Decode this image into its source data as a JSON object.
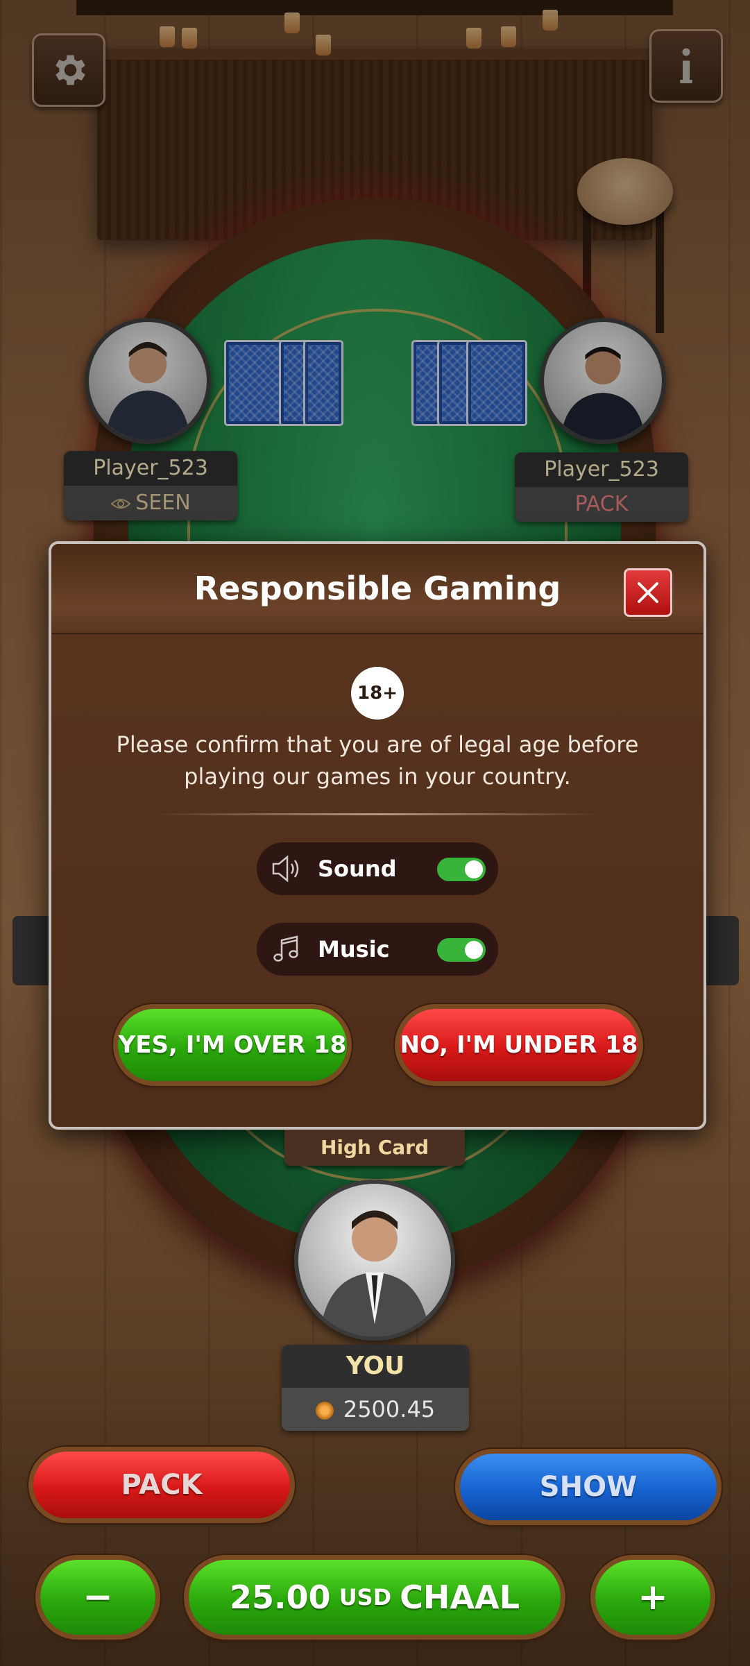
{
  "top_bar": {
    "settings_icon": "gear-icon",
    "info_icon": "info-icon"
  },
  "players": {
    "left": {
      "name": "Player_523",
      "status": "SEEN",
      "status_icon": "eye-icon"
    },
    "right": {
      "name": "Player_523",
      "status": "PACK",
      "status_color": "#e07a7a"
    }
  },
  "modal": {
    "title": "Responsible Gaming",
    "age_badge": "18+",
    "message_line1": "Please confirm that you are of legal age before",
    "message_line2": "playing our games in your country.",
    "toggles": [
      {
        "label": "Sound",
        "icon": "speaker-icon",
        "on": true
      },
      {
        "label": "Music",
        "icon": "music-note-icon",
        "on": true
      }
    ],
    "yes_label": "YES, I'M OVER  18",
    "no_label": "NO, I'M UNDER 18"
  },
  "hand_name": "High Card",
  "self": {
    "name": "YOU",
    "balance": "2500.45"
  },
  "actions": {
    "pack_label": "PACK",
    "show_label": "SHOW",
    "minus_label": "−",
    "plus_label": "+",
    "bet_amount": "25.00",
    "bet_currency": "USD",
    "bet_action": "CHAAL"
  },
  "colors": {
    "green": "#2aa80c",
    "red": "#d81818",
    "blue": "#1662d0",
    "toggle_on": "#39b43a"
  }
}
